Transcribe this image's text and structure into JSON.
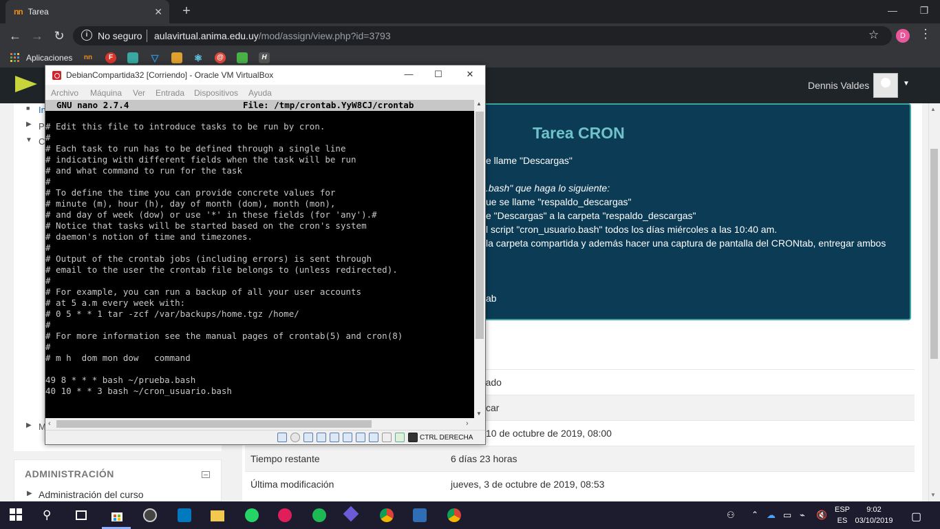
{
  "browser": {
    "tab_title": "Tarea",
    "tab_favicon": "nn",
    "omnibox_security": "No seguro",
    "url_host": "aulavirtual.anima.edu.uy",
    "url_path": "/mod/assign/view.php?id=3793",
    "profile_initial": "D",
    "bookmarks_apps_label": "Aplicaciones",
    "bookmark_labels": [
      "nn",
      "F",
      "",
      "",
      "",
      "",
      "@",
      "",
      "H"
    ]
  },
  "moodle": {
    "user_name": "Dennis Valdes",
    "left_nav_items": [
      "In",
      "P",
      "C",
      "M"
    ],
    "admin_title": "ADMINISTRACIÓN",
    "admin_item": "Administración del curso",
    "task_title": "Tarea CRON",
    "task_lines": [
      "e llame \"Descargas\"",
      ".bash\" que haga lo siguiente:",
      "ue se llame \"respaldo_descargas\"",
      "e \"Descargas\" a la carpeta \"respaldo_descargas\"",
      "l script \"cron_usuario.bash\" todos los días miércoles a las 10:40 am.",
      "la carpeta compartida y además hacer una captura de pantalla del CRONtab, entregar ambos",
      "ab"
    ],
    "status_rows": [
      {
        "label": "",
        "value": "egado"
      },
      {
        "label": "",
        "value": "car"
      },
      {
        "label": "",
        "value": "10 de octubre de 2019, 08:00"
      },
      {
        "label": "Tiempo restante",
        "value": "6 días 23 horas"
      },
      {
        "label": "Última modificación",
        "value": "jueves, 3 de octubre de 2019, 08:53"
      }
    ]
  },
  "vbox": {
    "title": "DebianCompartida32 [Corriendo] - Oracle VM VirtualBox",
    "menu": [
      "Archivo",
      "Máquina",
      "Ver",
      "Entrada",
      "Dispositivos",
      "Ayuda"
    ],
    "host_key": "CTRL DERECHA",
    "nano_version": "GNU nano 2.7.4",
    "nano_file": "File: /tmp/crontab.YyW8CJ/crontab",
    "terminal_lines": [
      "# Edit this file to introduce tasks to be run by cron.",
      "#",
      "# Each task to run has to be defined through a single line",
      "# indicating with different fields when the task will be run",
      "# and what command to run for the task",
      "#",
      "# To define the time you can provide concrete values for",
      "# minute (m), hour (h), day of month (dom), month (mon),",
      "# and day of week (dow) or use '*' in these fields (for 'any').#",
      "# Notice that tasks will be started based on the cron's system",
      "# daemon's notion of time and timezones.",
      "#",
      "# Output of the crontab jobs (including errors) is sent through",
      "# email to the user the crontab file belongs to (unless redirected).",
      "#",
      "# For example, you can run a backup of all your user accounts",
      "# at 5 a.m every week with:",
      "# 0 5 * * 1 tar -zcf /var/backups/home.tgz /home/",
      "#",
      "# For more information see the manual pages of crontab(5) and cron(8)",
      "#",
      "# m h  dom mon dow   command",
      "",
      "49 8 * * * bash ~/prueba.bash",
      "40 10 * * 3 bash ~/cron_usuario.bash"
    ]
  },
  "taskbar": {
    "lang_top": "ESP",
    "lang_bottom": "ES",
    "time": "9:02",
    "date": "03/10/2019"
  }
}
